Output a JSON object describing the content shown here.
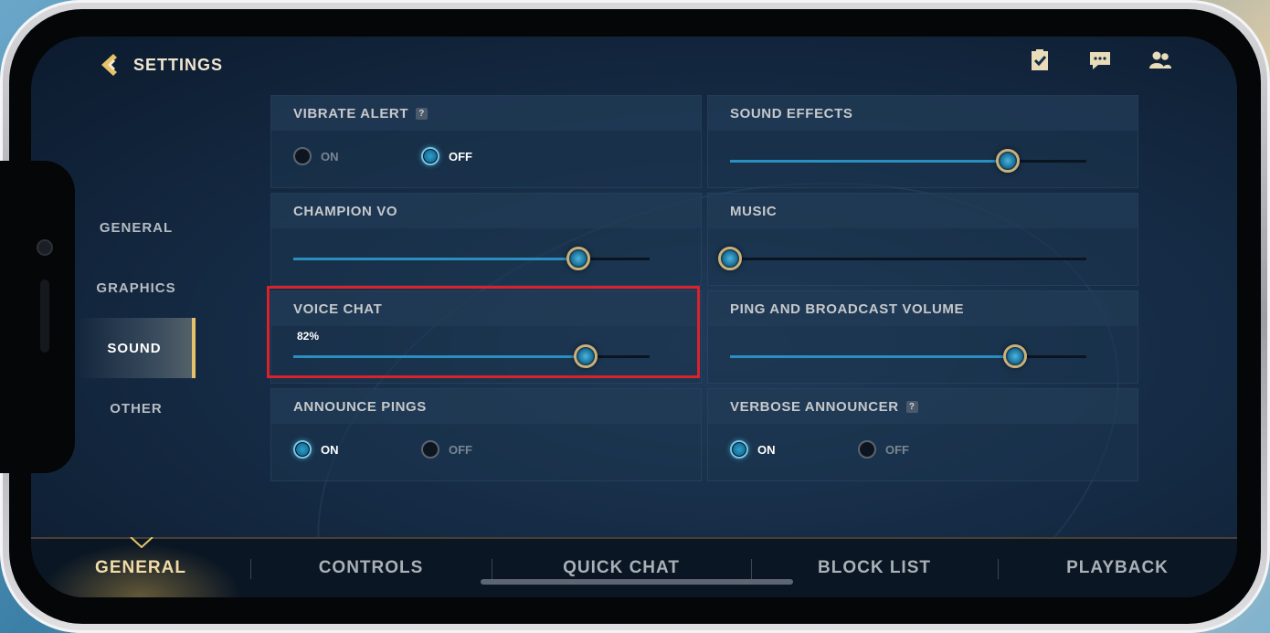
{
  "header": {
    "title": "SETTINGS"
  },
  "top_icons": [
    "clipboard-check-icon",
    "chat-icon",
    "friends-icon"
  ],
  "sidebar": {
    "items": [
      {
        "label": "GENERAL",
        "active": false
      },
      {
        "label": "GRAPHICS",
        "active": false
      },
      {
        "label": "SOUND",
        "active": true
      },
      {
        "label": "OTHER",
        "active": false
      }
    ]
  },
  "settings": {
    "vibrate_alert": {
      "title": "VIBRATE ALERT",
      "help": "?",
      "on_label": "ON",
      "off_label": "OFF",
      "selected": "OFF"
    },
    "sound_effects": {
      "title": "SOUND EFFECTS",
      "value": 0.78
    },
    "champion_vo": {
      "title": "CHAMPION VO",
      "value": 0.8
    },
    "music": {
      "title": "MUSIC",
      "value": 0.0
    },
    "voice_chat": {
      "title": "VOICE CHAT",
      "value_label": "82%",
      "value": 0.82
    },
    "ping_broadcast": {
      "title": "PING AND BROADCAST VOLUME",
      "value": 0.8
    },
    "announce_pings": {
      "title": "ANNOUNCE PINGS",
      "on_label": "ON",
      "off_label": "OFF",
      "selected": "ON"
    },
    "verbose_announcer": {
      "title": "VERBOSE ANNOUNCER",
      "help": "?",
      "on_label": "ON",
      "off_label": "OFF",
      "selected": "ON"
    }
  },
  "bottom_tabs": [
    {
      "label": "GENERAL",
      "active": true
    },
    {
      "label": "CONTROLS",
      "active": false
    },
    {
      "label": "QUICK CHAT",
      "active": false
    },
    {
      "label": "BLOCK LIST",
      "active": false
    },
    {
      "label": "PLAYBACK",
      "active": false
    }
  ],
  "colors": {
    "accent_gold": "#e6c36a",
    "slider_blue": "#2a8fc0",
    "highlight_red": "#d9222b"
  }
}
